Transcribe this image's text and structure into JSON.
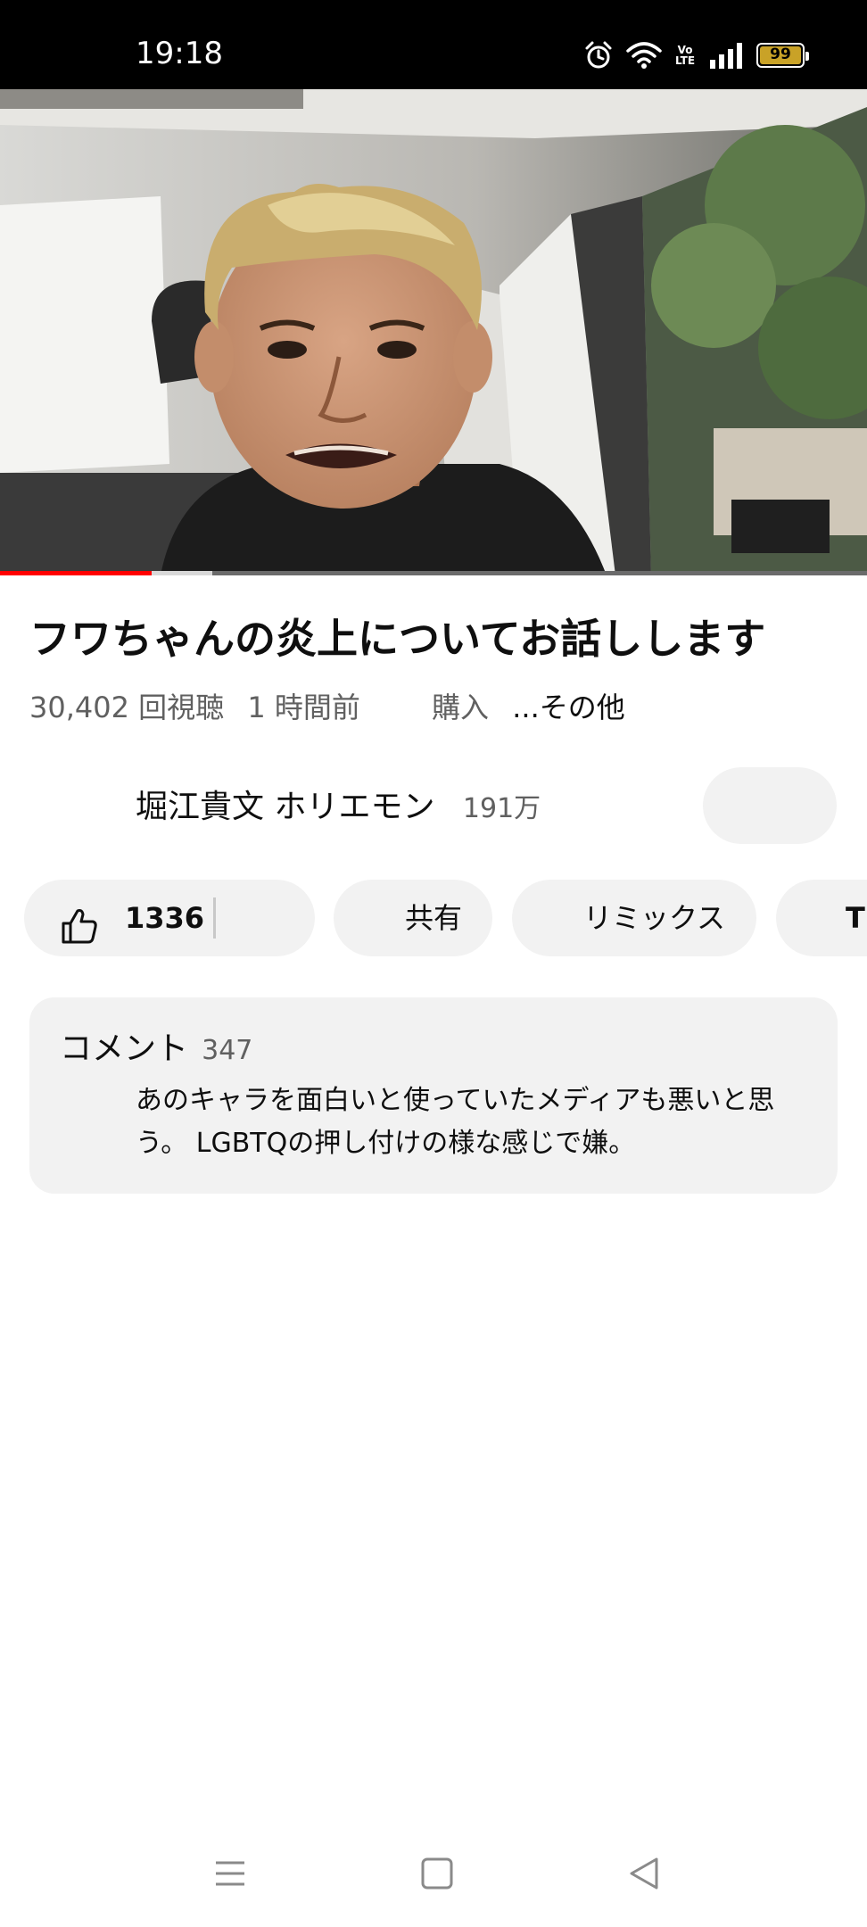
{
  "status_bar": {
    "time": "19:18",
    "volte_label": "Vo\nLTE",
    "battery_level": "99",
    "battery_fill_fraction": 0.99,
    "battery_color": "#c9a227",
    "icons": [
      "alarm-icon",
      "wifi-icon",
      "volte-icon",
      "signal-icon",
      "battery-icon"
    ]
  },
  "video": {
    "progress_played_fraction": 0.175,
    "progress_buffered_fraction": 0.245,
    "progress_color": "#ff0000"
  },
  "title": "フワちゃんの炎上についてお話しします",
  "meta": {
    "views": "30,402 回視聴",
    "age": "1 時間前",
    "purchase": "購入",
    "more": "...その他"
  },
  "channel": {
    "name": "堀江貴文 ホリエモン",
    "subscribers": "191万"
  },
  "actions": {
    "like_count": "1336",
    "share_label": "共有",
    "remix_label": "リミックス",
    "thanks_label": "Th"
  },
  "comments": {
    "title": "コメント",
    "count": "347",
    "top_comment": "あのキャラを面白いと使っていたメディアも悪いと思う。 LGBTQの押し付けの様な感じで嫌。"
  },
  "nav": {
    "icons": [
      "menu-icon",
      "home-square-icon",
      "back-triangle-icon"
    ]
  }
}
